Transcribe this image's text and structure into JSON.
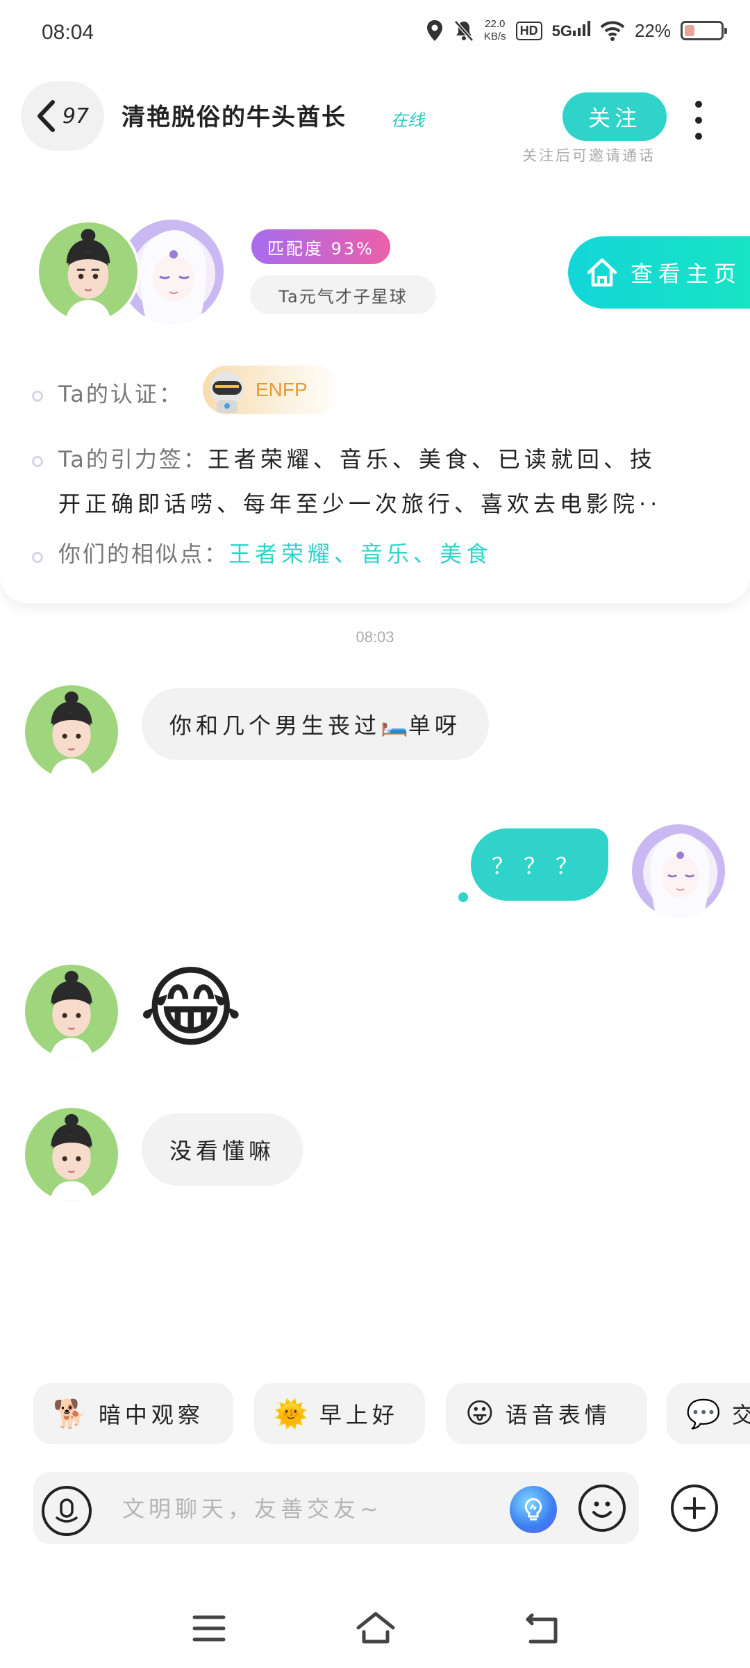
{
  "status_bar": {
    "time": "08:04",
    "net_speed_value": "22.0",
    "net_speed_unit": "KB/s",
    "hd_label": "HD",
    "signal_label": "5G",
    "battery_percent": "22%",
    "battery_level": 0.22
  },
  "header": {
    "back_count": "97",
    "title": "清艳脱俗的牛头酋长",
    "online_status": "在线",
    "follow_label": "关注",
    "follow_hint": "关注后可邀请通话"
  },
  "profile_card": {
    "match_label": "匹配度 93%",
    "planet_tag": "Ta元气才子星球",
    "home_button_label": "查看主页",
    "cert_label": "Ta的认证：",
    "mbti": "ENFP",
    "tags_label": "Ta的引力签：",
    "tags_line1": "王者荣耀、音乐、美食、已读就回、技",
    "tags_line2": "开正确即话唠、每年至少一次旅行、喜欢去电影院··",
    "similar_label": "你们的相似点：",
    "similar_values": "王者荣耀、音乐、美食"
  },
  "chat": {
    "timestamp": "08:03",
    "messages": [
      {
        "from": "other",
        "text_before": "你和几个男生丧过",
        "emoji": "🛏️",
        "text_after": "单呀"
      },
      {
        "from": "me",
        "text": "？？？"
      },
      {
        "from": "other",
        "emoji": "😂"
      },
      {
        "from": "other",
        "text": "没看懂嘛"
      }
    ]
  },
  "quick_replies": [
    {
      "icon": "🐕",
      "label": "暗中观察"
    },
    {
      "icon": "🌞",
      "label": "早上好"
    },
    {
      "icon": "😛",
      "label": "语音表情"
    },
    {
      "icon": "💬",
      "label": "交"
    }
  ],
  "input": {
    "placeholder": "文明聊天，友善交友~"
  },
  "colors": {
    "accent": "#2fd3c9",
    "match_gradient_start": "#a66cf0",
    "match_gradient_end": "#ec5fa8",
    "mbti_text": "#e59a34"
  }
}
